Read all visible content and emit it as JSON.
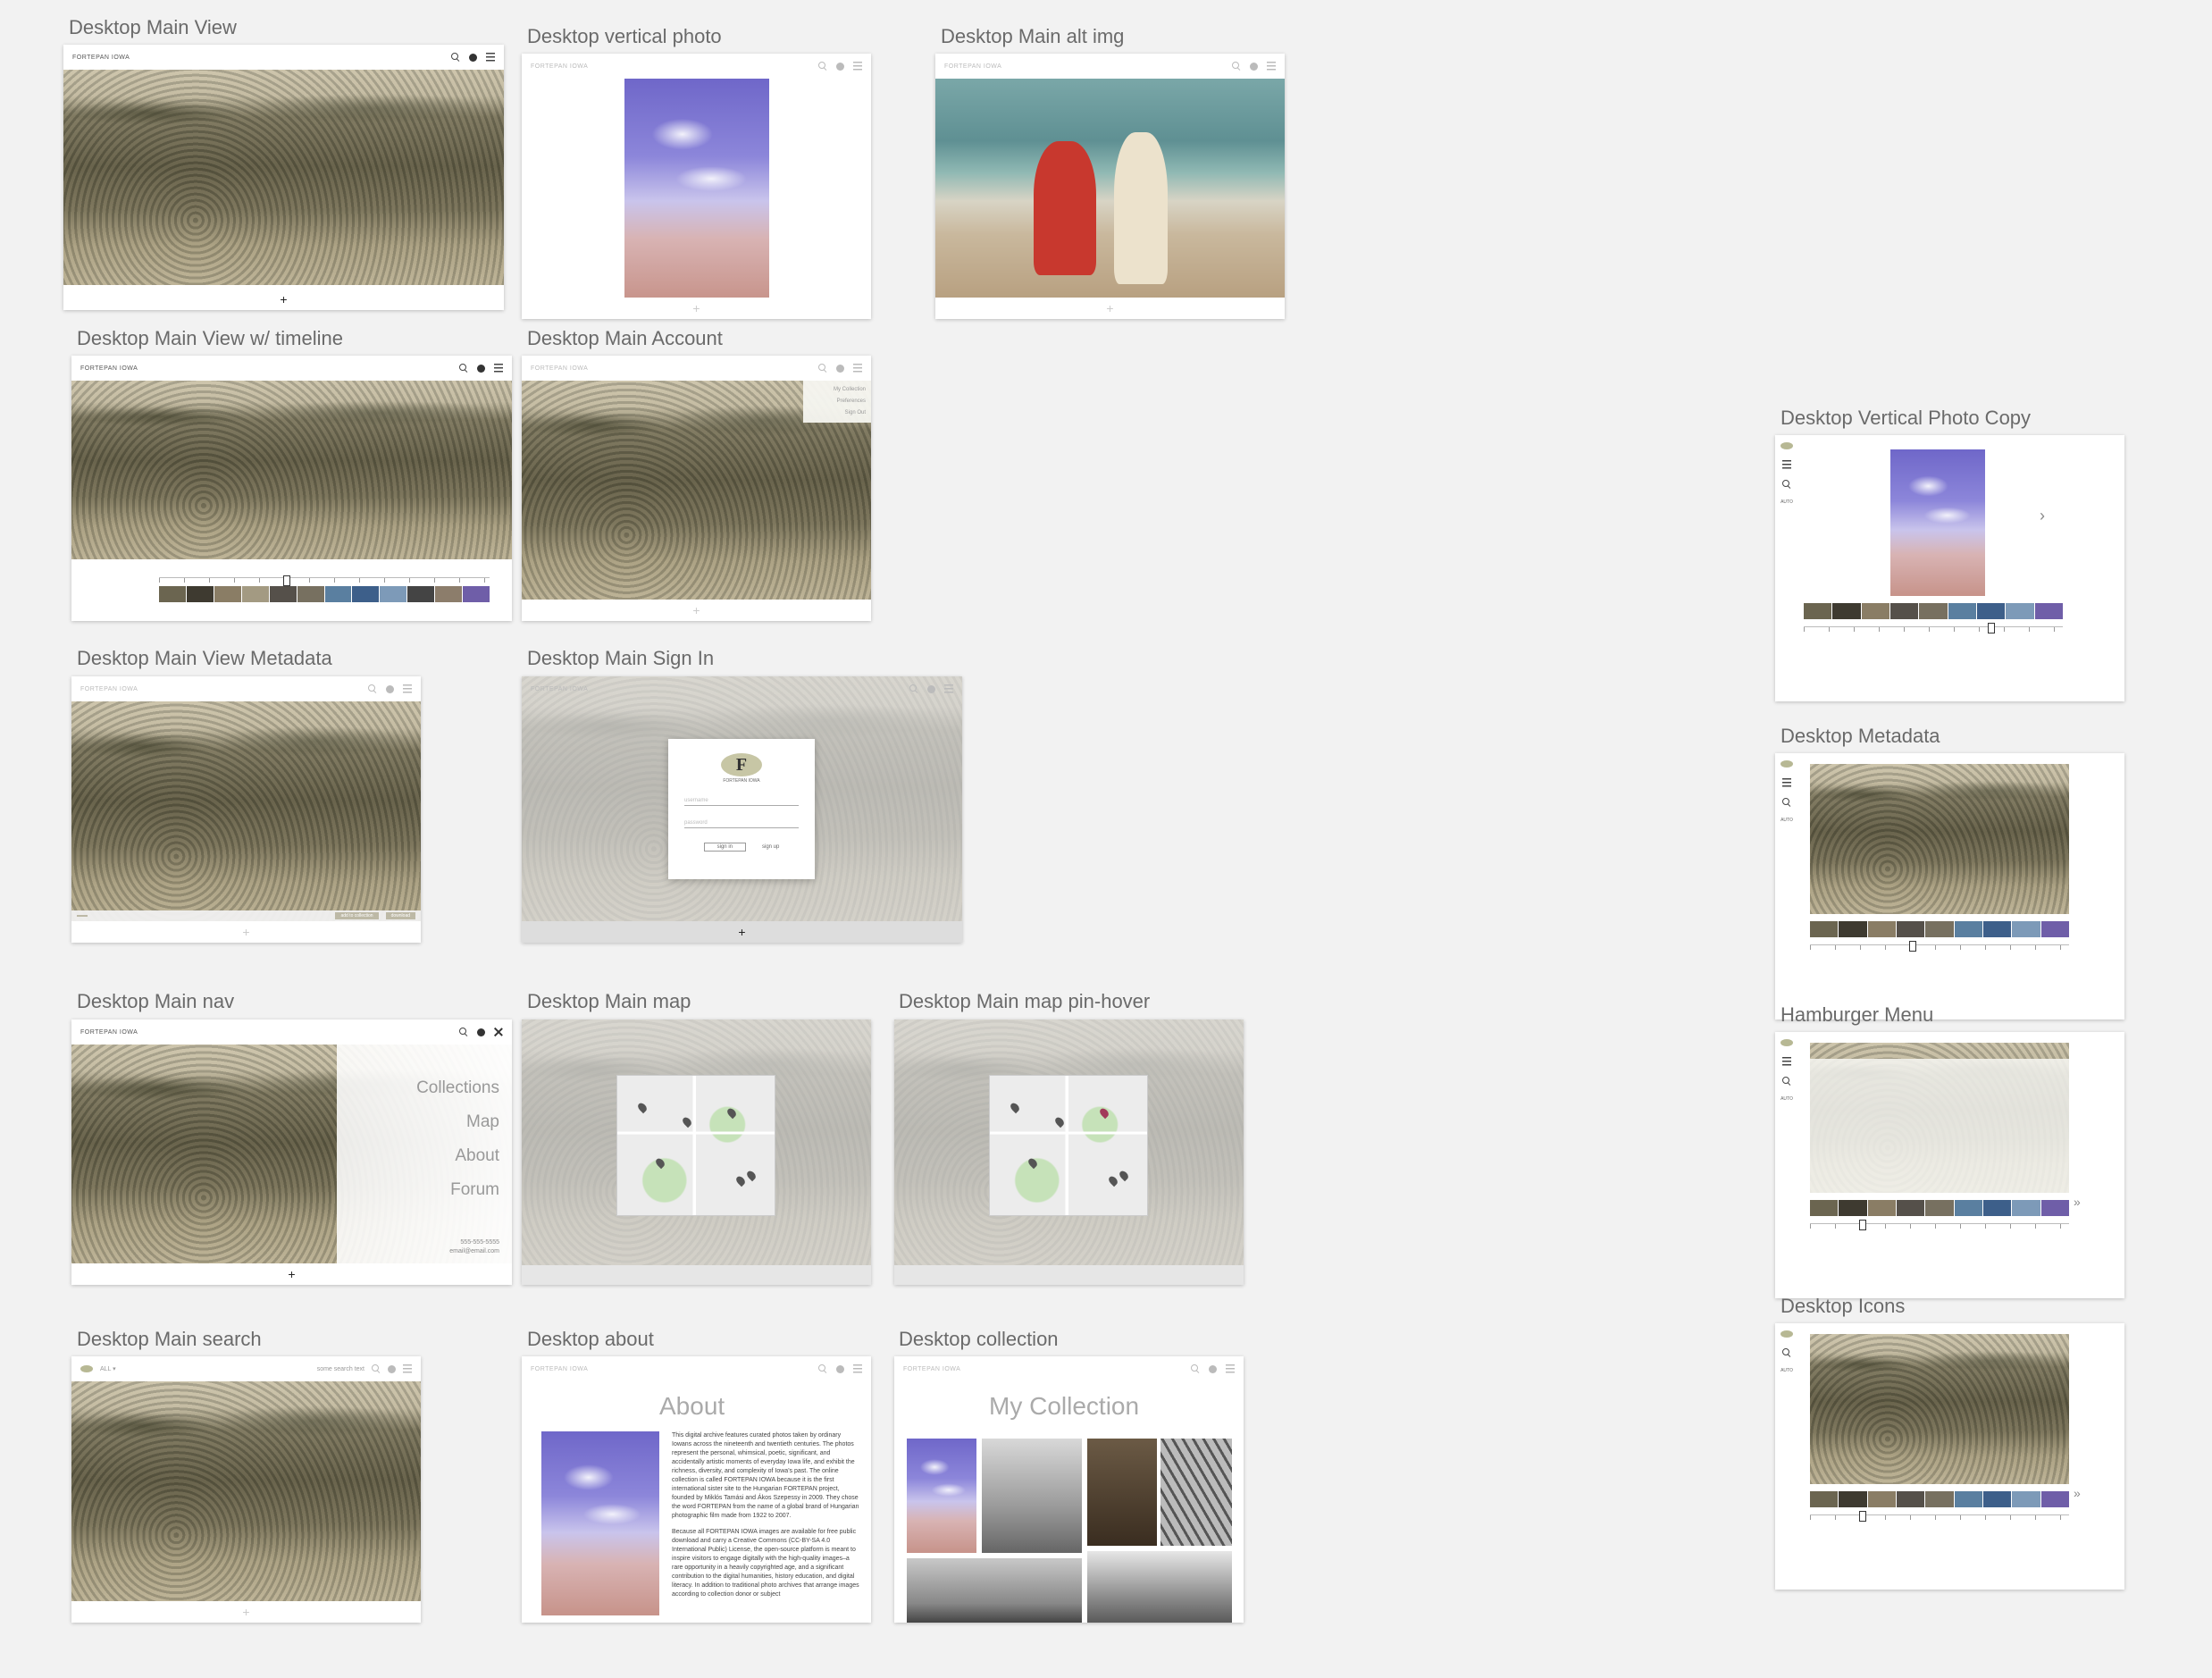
{
  "colors": {
    "canvas_bg": "#f2f2f2",
    "label_text": "#6a6a6a",
    "menu_text": "#999999",
    "pin_highlight": "#a23a5a",
    "logo_olive": "#c7c6a5"
  },
  "brand": {
    "name": "FORTEPAN IOWA",
    "logo_letter": "F"
  },
  "icons": {
    "search": "search-icon",
    "account": "user-icon",
    "menu": "hamburger-icon",
    "close": "close-icon",
    "add": "plus-icon",
    "next": "chevron-right-icon"
  },
  "frames": {
    "main_view": "Desktop Main View",
    "vertical_photo": "Desktop vertical photo",
    "main_alt_img": "Desktop Main alt img",
    "main_timeline": "Desktop Main View w/ timeline",
    "main_account": "Desktop Main Account",
    "main_metadata": "Desktop Main View Metadata",
    "main_sign_in": "Desktop Main Sign In",
    "main_nav": "Desktop Main nav",
    "main_map": "Desktop Main map",
    "main_map_hover": "Desktop Main map pin-hover",
    "main_search": "Desktop Main search",
    "about": "Desktop about",
    "collection": "Desktop collection",
    "vertical_copy": "Desktop Vertical Photo Copy",
    "metadata": "Desktop Metadata",
    "hamburger": "Hamburger Menu",
    "icons": "Desktop Icons"
  },
  "footer": {
    "add_symbol": "+"
  },
  "account_menu": [
    "My Collection",
    "Preferences",
    "Sign Out"
  ],
  "nav_menu": {
    "items": [
      "Collections",
      "Map",
      "About",
      "Forum"
    ],
    "phone": "555-555-5555",
    "email": "email@email.com"
  },
  "sign_in": {
    "username_placeholder": "username",
    "password_placeholder": "password",
    "sign_in_label": "sign in",
    "sign_up_label": "sign up"
  },
  "search": {
    "filter": "ALL ▾",
    "placeholder": "some search text"
  },
  "metadata_buttons": {
    "add": "add to collection",
    "download": "download"
  },
  "about": {
    "title": "About",
    "paragraph1": "This digital archive features curated photos taken by ordinary Iowans across the nineteenth and twentieth centuries. The photos represent the personal, whimsical, poetic, significant, and accidentally artistic moments of everyday Iowa life, and exhibit the richness, diversity, and complexity of Iowa's past. The online collection is called FORTEPAN IOWA because it is the first international sister site to the Hungarian FORTEPAN project, founded by Miklós Tamási and Ákos Szepessy in 2009. They chose the word FORTEPAN from the name of a global brand of Hungarian photographic film made from 1922 to 2007.",
    "paragraph2": "Because all FORTEPAN IOWA images are available for free public download and carry a Creative Commons (CC-BY-SA 4.0 International Public) License, the open-source platform is meant to inspire visitors to engage digitally with the high-quality images–a rare opportunity in a heavily copyrighted age, and a significant contribution to the digital humanities, history education, and digital literacy. In addition to traditional photo archives that arrange images according to collection donor or subject"
  },
  "collection": {
    "title": "My Collection"
  },
  "sidebar": {
    "auto_label": "AUTO"
  }
}
